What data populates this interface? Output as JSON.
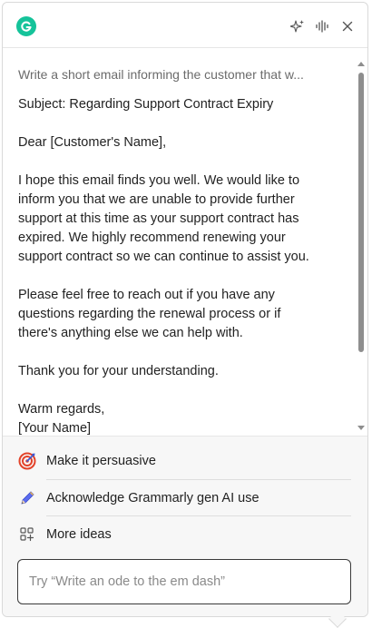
{
  "header": {
    "logo_icon": "grammarly-logo-icon",
    "actions": [
      "sparkle-icon",
      "voice-waveform-icon",
      "close-icon"
    ]
  },
  "prompt": "Write a short email informing the customer that w...",
  "letter": {
    "subject": "Subject: Regarding Support Contract Expiry",
    "greeting": "Dear [Customer's Name],",
    "paragraph1_lines": [
      "I hope this email finds you well. We would like to",
      "inform you that we are unable to provide further",
      "support at this time as your support contract has",
      "expired. We highly recommend renewing your",
      "support contract so we can continue to assist you."
    ],
    "paragraph2_lines": [
      "Please feel free to reach out if you have any",
      "questions regarding the renewal process or if",
      "there's anything else we can help with."
    ],
    "thanks": "Thank you for your understanding.",
    "closing": "Warm regards,",
    "signature": "[Your Name]"
  },
  "suggestions": [
    {
      "label": "Make it persuasive",
      "icon": "target-icon"
    },
    {
      "label": "Acknowledge Grammarly gen AI use",
      "icon": "pen-icon"
    },
    {
      "label": "More ideas",
      "icon": "more-ideas-grid-icon"
    }
  ],
  "input": {
    "placeholder": "Try “Write an ode to the em dash”",
    "value": ""
  },
  "colors": {
    "brand": "#15c39a",
    "target_red": "#e3432a",
    "scroll_thumb": "#8e8e8e"
  }
}
